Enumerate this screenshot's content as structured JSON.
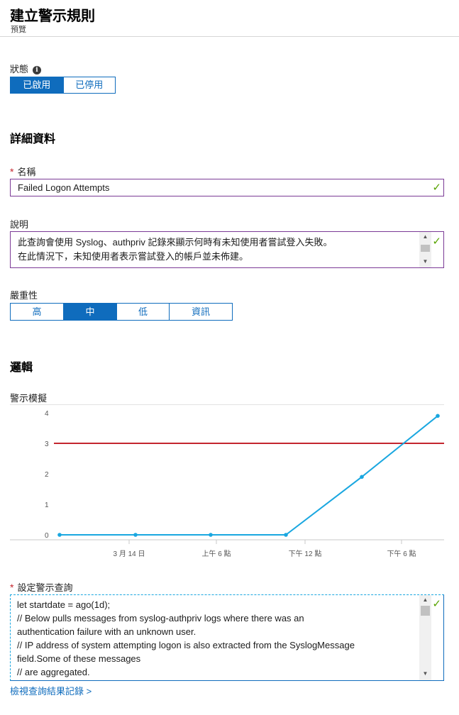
{
  "header": {
    "title": "建立警示規則",
    "subtitle": "預覽"
  },
  "status": {
    "label": "狀態",
    "info_icon": "info-icon",
    "options": [
      "已啟用",
      "已停用"
    ],
    "selected": "已啟用"
  },
  "details": {
    "section_title": "詳細資料",
    "name_label": "名稱",
    "name_value": "Failed Logon Attempts",
    "description_label": "說明",
    "description_lines": [
      " 此查詢會使用 Syslog、authpriv 記錄來顯示何時有未知使用者嘗試登入失敗。",
      "在此情況下，未知使用者表示嘗試登入的帳戶並未佈建。"
    ],
    "severity_label": "嚴重性",
    "severity_options": [
      "高",
      "中",
      "低",
      "資訊"
    ],
    "severity_selected": "中"
  },
  "logic": {
    "section_title": "邏輯",
    "simulation_label": "警示模擬",
    "query_label": "設定警示查詢",
    "query_lines": [
      "let startdate = ago(1d);",
      "// Below pulls messages from syslog-authpriv logs where there was an",
      "authentication failure with an unknown user.",
      "// IP address of system attempting logon is also extracted from the SyslogMessage",
      "field.Some of these messages",
      "// are aggregated."
    ],
    "view_results_link": "檢視查詢結果記錄 >"
  },
  "colors": {
    "accent": "#0f6cbd",
    "threshold": "#c4262e",
    "series": "#1aa7e0",
    "valid": "#57a300",
    "focus_border": "#7b3a96"
  },
  "chart_data": {
    "type": "line",
    "x_tick_labels": [
      "3 月 14 日",
      "上午 6 點",
      "下午 12 點",
      "下午 6 點"
    ],
    "y_ticks": [
      0,
      1,
      2,
      3,
      4
    ],
    "ylim": [
      0,
      4
    ],
    "series": [
      {
        "values": [
          0,
          0,
          0,
          0,
          1.9,
          3.9
        ]
      }
    ],
    "threshold": 3,
    "grid": false
  }
}
